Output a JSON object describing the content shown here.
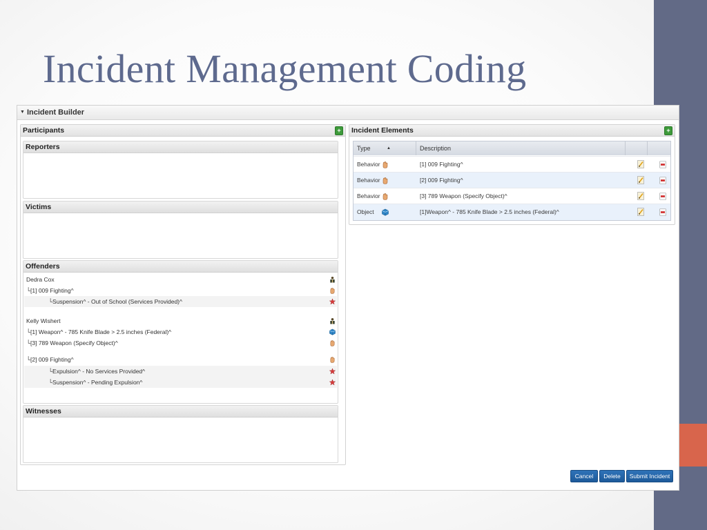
{
  "slide": {
    "title": "Incident Management Coding"
  },
  "builder": {
    "title": "Incident Builder"
  },
  "participants": {
    "title": "Participants",
    "reporters": {
      "title": "Reporters"
    },
    "victims": {
      "title": "Victims"
    },
    "offenders": {
      "title": "Offenders",
      "lines": [
        {
          "text": "Dedra Cox",
          "icon": "person-icon"
        },
        {
          "text": "└[1] 009 Fighting^",
          "icon": "hand-icon"
        },
        {
          "text": "└Suspension^ - Out of School (Services Provided)^",
          "icon": "star-icon"
        },
        {
          "text": "Kelly Wishert",
          "icon": "person-icon"
        },
        {
          "text": "└[1] Weapon^ - 785 Knife Blade > 2.5 inches (Federal)^",
          "icon": "cube-icon"
        },
        {
          "text": "└[3] 789 Weapon (Specify Object)^",
          "icon": "hand-icon"
        },
        {
          "text": "└[2] 009 Fighting^",
          "icon": "hand-icon"
        },
        {
          "text": "└Expulsion^ - No Services Provided^",
          "icon": "star-icon"
        },
        {
          "text": "└Suspension^ - Pending Expulsion^",
          "icon": "star-icon"
        }
      ]
    },
    "witnesses": {
      "title": "Witnesses"
    }
  },
  "elements": {
    "title": "Incident Elements",
    "columns": {
      "type": "Type",
      "sort": "▲",
      "description": "Description"
    },
    "rows": [
      {
        "type": "Behavior",
        "icon": "hand-icon",
        "description": "[1] 009 Fighting^"
      },
      {
        "type": "Behavior",
        "icon": "hand-icon",
        "description": "[2] 009 Fighting^"
      },
      {
        "type": "Behavior",
        "icon": "hand-icon",
        "description": "[3] 789 Weapon (Specify Object)^"
      },
      {
        "type": "Object",
        "icon": "cube-icon",
        "description": "[1]Weapon^ - 785 Knife Blade > 2.5 inches (Federal)^"
      }
    ]
  },
  "buttons": {
    "cancel": "Cancel",
    "delete": "Delete",
    "submit": "Submit Incident"
  },
  "colors": {
    "side_bar": "#626a86",
    "accent": "#d8654c",
    "title": "#5e6a8e",
    "button": "#1d5a9a"
  }
}
